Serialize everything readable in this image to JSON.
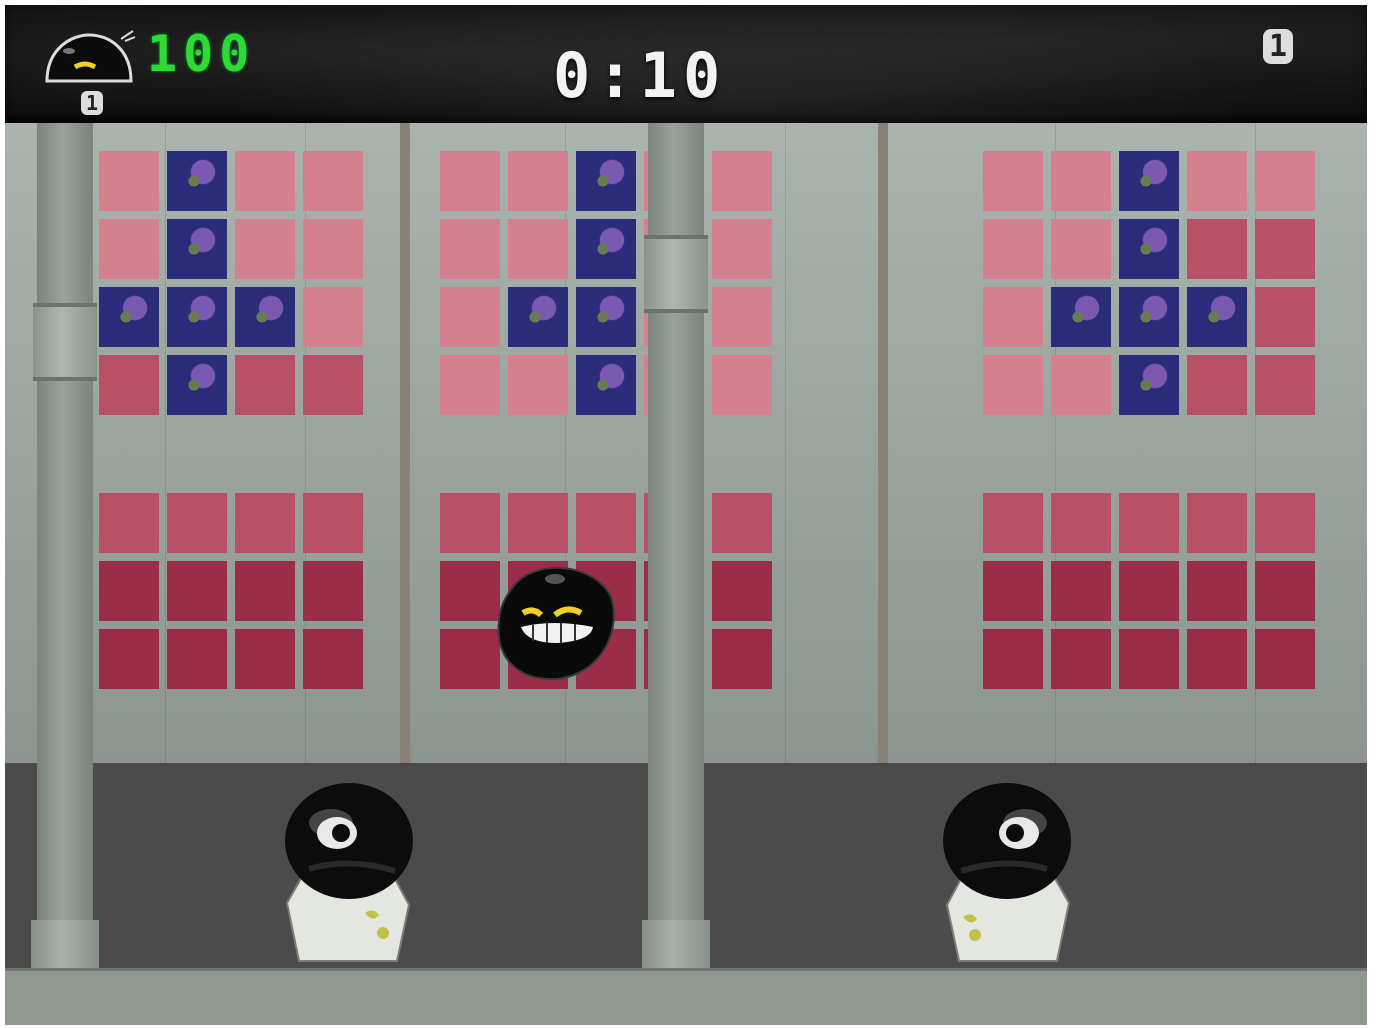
{
  "hud": {
    "score": "100",
    "timer": "0:10",
    "lives": "1",
    "right_counter": "1"
  },
  "icons": {
    "player": "black-blob-head-icon",
    "enemy": "grinning-black-ball",
    "guard": "one-eyed-black-blob-in-white-coat"
  },
  "colors": {
    "score_green": "#2edb36",
    "hud_bg": "#111111",
    "window_pink": "#d4808e",
    "window_red": "#9a2e48",
    "wall_grey": "#aab3ad",
    "floor_dark": "#4b4b4b"
  }
}
